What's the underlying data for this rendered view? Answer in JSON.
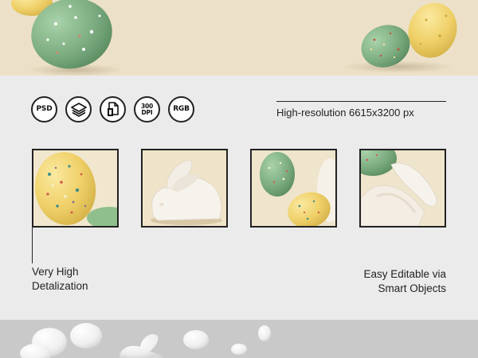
{
  "badges": [
    {
      "label": "PSD",
      "icon": "psd-icon"
    },
    {
      "label": "",
      "icon": "layers-icon"
    },
    {
      "label": "",
      "icon": "file-copy-icon"
    },
    {
      "label": "300\nDPI",
      "icon": "dpi-icon"
    },
    {
      "label": "RGB",
      "icon": "rgb-icon"
    }
  ],
  "resolution_text": "High-resolution 6615x3200 px",
  "caption_left": {
    "line1": "Very High",
    "line2": "Detalization"
  },
  "caption_right": {
    "line1": "Easy Editable via",
    "line2": "Smart Objects"
  },
  "colors": {
    "hero_background": "#ece1c8",
    "panel_background": "#ebebeb",
    "footer_background": "#c9c9c9",
    "egg_green": "#82b287",
    "egg_yellow": "#f0d26a",
    "bunny_white": "#f4f0ea"
  }
}
